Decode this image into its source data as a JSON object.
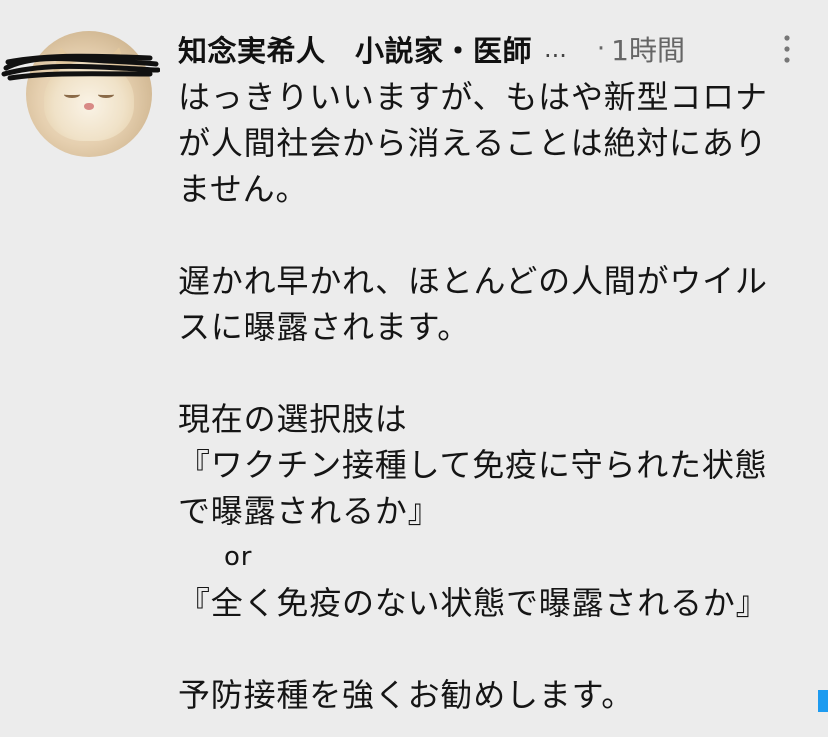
{
  "author": {
    "name": "知念実希人　小説家・医師",
    "name_truncation": "...",
    "separator": "·",
    "timestamp": "1時間"
  },
  "post": {
    "lines": [
      "はっきりいいますが、もはや新型コロナ",
      "が人間社会から消えることは絶対にあり",
      "ません。",
      "遅かれ早かれ、ほとんどの人間がウイル",
      "スに曝露されます。",
      "現在の選択肢は",
      "『ワクチン接種して免疫に守られた状態",
      "で曝露されるか』",
      "or",
      "『全く免疫のない状態で曝露されるか』",
      "予防接種を強くお勧めします。"
    ]
  },
  "icons": {
    "more": "vertical-ellipsis-icon",
    "redaction": "scribble-redaction",
    "avatar": "cat-avatar"
  },
  "colors": {
    "background": "#ececec",
    "text": "#151515",
    "meta": "#666666",
    "redaction": "#111111"
  }
}
